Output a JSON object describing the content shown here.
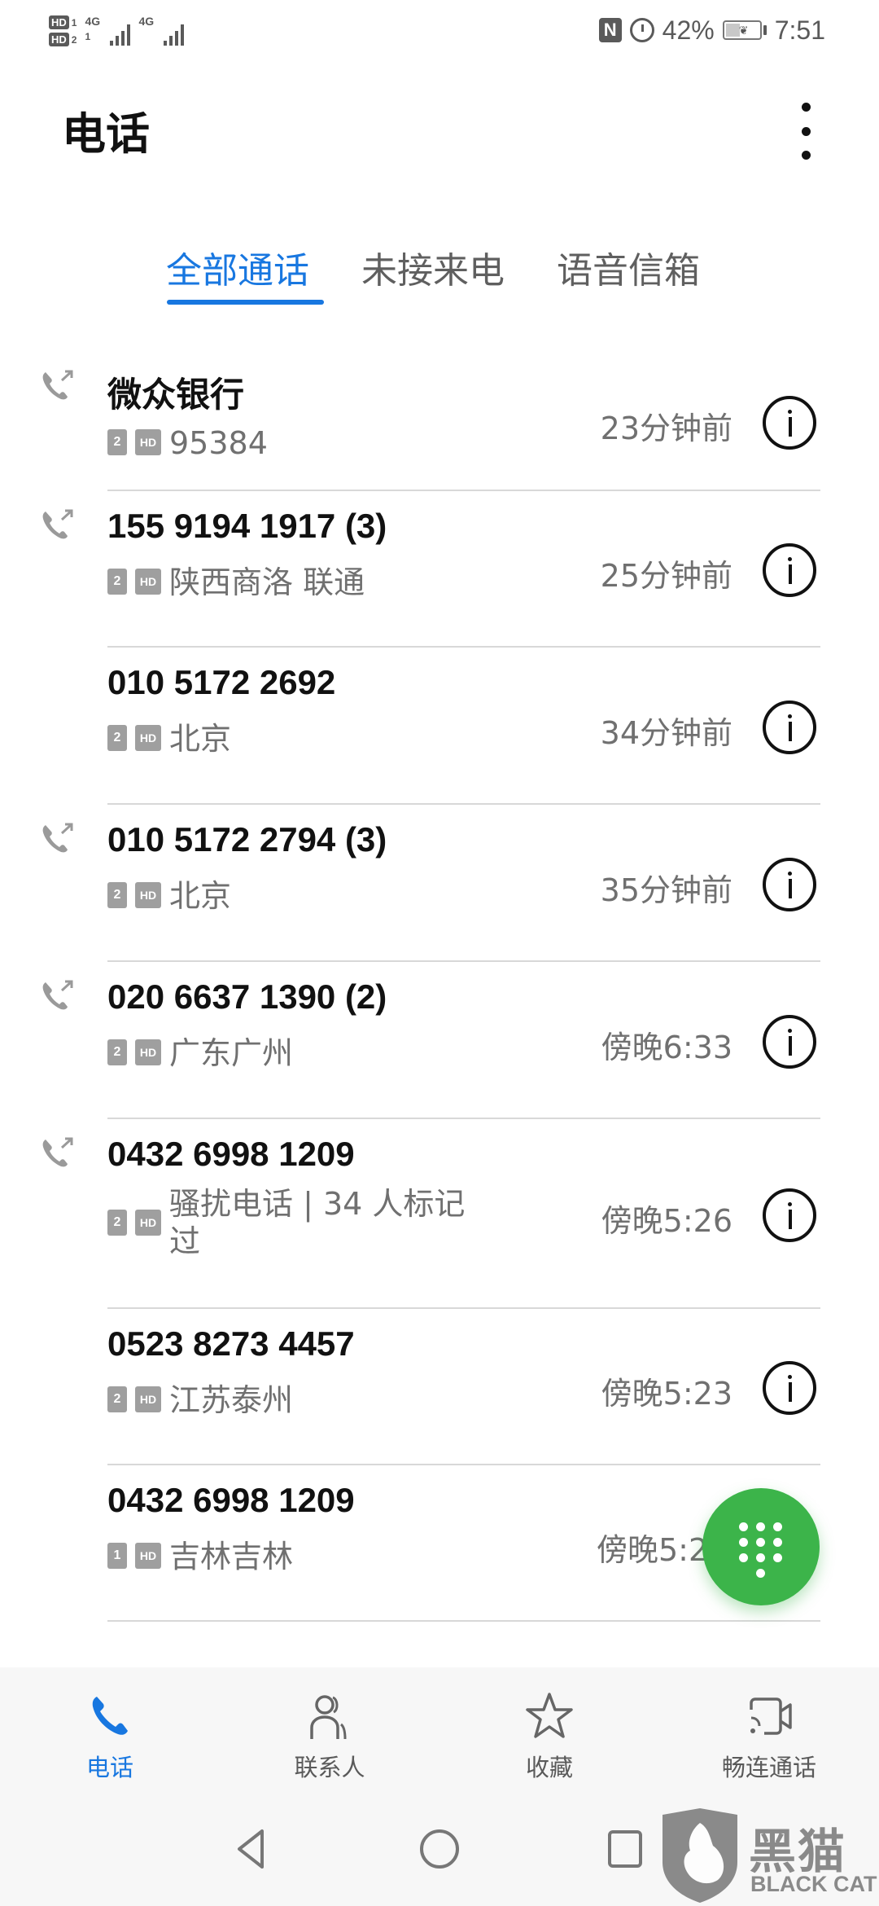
{
  "status_bar": {
    "sim1_label": "HD",
    "sim1_index": "1",
    "sim2_label": "HD",
    "sim2_index": "2",
    "network1": "4G",
    "network2": "4G",
    "nfc_label": "N",
    "battery_percent_text": "42%",
    "battery_level": 0.42,
    "time": "7:51",
    "icons": [
      "hd-voice-icon",
      "signal-icon",
      "nfc-icon",
      "alarm-icon",
      "battery-saver-icon"
    ]
  },
  "app_bar": {
    "title": "电话",
    "more_icon": "more-vertical-icon"
  },
  "tabs": [
    {
      "label": "全部通话",
      "active": true
    },
    {
      "label": "未接来电",
      "active": false
    },
    {
      "label": "语音信箱",
      "active": false
    }
  ],
  "calls": [
    {
      "name": "微众银行",
      "sim": "2",
      "hd": "HD",
      "location": "95384",
      "time": "23分钟前",
      "outgoing": true
    },
    {
      "name": "155 9194 1917 (3)",
      "sim": "2",
      "hd": "HD",
      "location": "陕西商洛 联通",
      "time": "25分钟前",
      "outgoing": true
    },
    {
      "name": "010 5172 2692",
      "sim": "2",
      "hd": "HD",
      "location": "北京",
      "time": "34分钟前",
      "outgoing": false
    },
    {
      "name": "010 5172 2794 (3)",
      "sim": "2",
      "hd": "HD",
      "location": "北京",
      "time": "35分钟前",
      "outgoing": true
    },
    {
      "name": "020 6637 1390 (2)",
      "sim": "2",
      "hd": "HD",
      "location": "广东广州",
      "time": "傍晚6:33",
      "outgoing": true
    },
    {
      "name": "0432 6998 1209",
      "sim": "2",
      "hd": "HD",
      "location": "骚扰电话 | 34 人标记过",
      "time": "傍晚5:26",
      "outgoing": true
    },
    {
      "name": "0523 8273 4457",
      "sim": "2",
      "hd": "HD",
      "location": "江苏泰州",
      "time": "傍晚5:23",
      "outgoing": false
    },
    {
      "name": "0432 6998 1209",
      "sim": "1",
      "hd": "HD",
      "location": "吉林吉林",
      "time": "傍晚5:2",
      "outgoing": false
    }
  ],
  "partial_call": {
    "name": "微众银行"
  },
  "fab": {
    "icon": "dialpad-icon",
    "color": "#3cb44a"
  },
  "bottom_nav": [
    {
      "label": "电话",
      "icon": "phone-icon",
      "active": true
    },
    {
      "label": "联系人",
      "icon": "contacts-icon",
      "active": false
    },
    {
      "label": "收藏",
      "icon": "star-icon",
      "active": false
    },
    {
      "label": "畅连通话",
      "icon": "video-call-icon",
      "active": false
    }
  ],
  "system_nav": [
    "back-icon",
    "home-icon",
    "recents-icon"
  ],
  "watermark": {
    "title": "黑猫",
    "subtitle": "BLACK CAT"
  },
  "colors": {
    "accent": "#1877e0",
    "fab": "#3cb44a",
    "secondary_text": "#707070"
  }
}
